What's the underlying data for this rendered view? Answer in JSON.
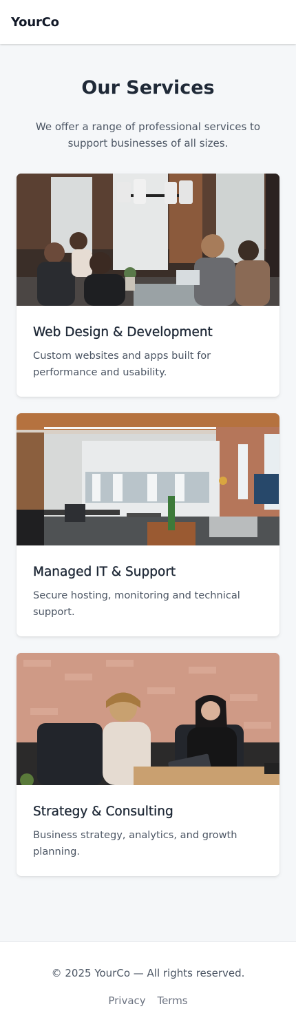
{
  "header": {
    "brand": "YourCo"
  },
  "hero": {
    "title": "Our Services",
    "intro": "We offer a range of professional services to support businesses of all sizes."
  },
  "services": [
    {
      "title": "Web Design & Development",
      "description": "Custom websites and apps built for performance and usability.",
      "image": "team-working-at-desks-photo"
    },
    {
      "title": "Managed IT & Support",
      "description": "Secure hosting, monitoring and technical support.",
      "image": "open-plan-office-photo"
    },
    {
      "title": "Strategy & Consulting",
      "description": "Business strategy, analytics, and growth planning.",
      "image": "consultation-meeting-photo"
    }
  ],
  "footer": {
    "copyright": "© 2025 YourCo — All rights reserved.",
    "links": [
      "Privacy",
      "Terms"
    ]
  }
}
